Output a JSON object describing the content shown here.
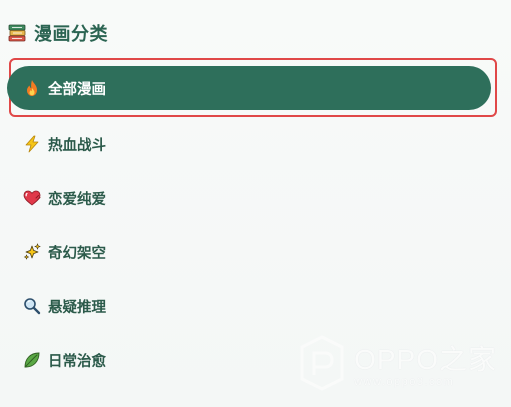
{
  "sidebar": {
    "title": "漫画分类",
    "title_icon": "books-icon",
    "items": [
      {
        "label": "全部漫画",
        "icon": "fire-icon",
        "active": true
      },
      {
        "label": "热血战斗",
        "icon": "lightning-icon",
        "active": false
      },
      {
        "label": "恋爱纯爱",
        "icon": "heart-icon",
        "active": false
      },
      {
        "label": "奇幻架空",
        "icon": "sparkles-icon",
        "active": false
      },
      {
        "label": "悬疑推理",
        "icon": "magnifier-icon",
        "active": false
      },
      {
        "label": "日常治愈",
        "icon": "leaf-icon",
        "active": false
      }
    ]
  },
  "watermark": {
    "brand": "OPPO之家",
    "url": "www.oppo3.com"
  },
  "colors": {
    "accent": "#2e6f5b",
    "text": "#2b5a4a",
    "highlight_border": "#e04848"
  }
}
